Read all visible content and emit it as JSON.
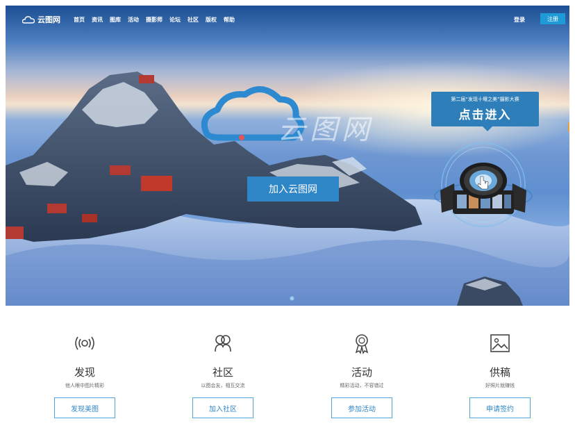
{
  "brand": {
    "name": "云图网"
  },
  "nav": {
    "items": [
      "首页",
      "资讯",
      "图库",
      "活动",
      "摄影师",
      "论坛",
      "社区",
      "版权",
      "帮助"
    ],
    "login_label": "登录",
    "register_label": "注册"
  },
  "hero": {
    "watermark": "云图网",
    "join_label": "加入云图网",
    "promo_sub": "第二届“发现十堰之美”摄影大赛",
    "promo_main": "点击进入"
  },
  "features": [
    {
      "icon": "broadcast-icon",
      "title": "发现",
      "desc": "他人眼中图片精彩",
      "button": "发现美图"
    },
    {
      "icon": "community-icon",
      "title": "社区",
      "desc": "以图会友，相互交流",
      "button": "加入社区"
    },
    {
      "icon": "award-icon",
      "title": "活动",
      "desc": "精彩活动，不容错过",
      "button": "参加活动"
    },
    {
      "icon": "picture-icon",
      "title": "供稿",
      "desc": "好照片就赚钱",
      "button": "申请签约"
    }
  ],
  "colors": {
    "accent": "#1e9ad6",
    "button_blue": "#2f86c6",
    "outline_blue": "#4fa5de"
  }
}
